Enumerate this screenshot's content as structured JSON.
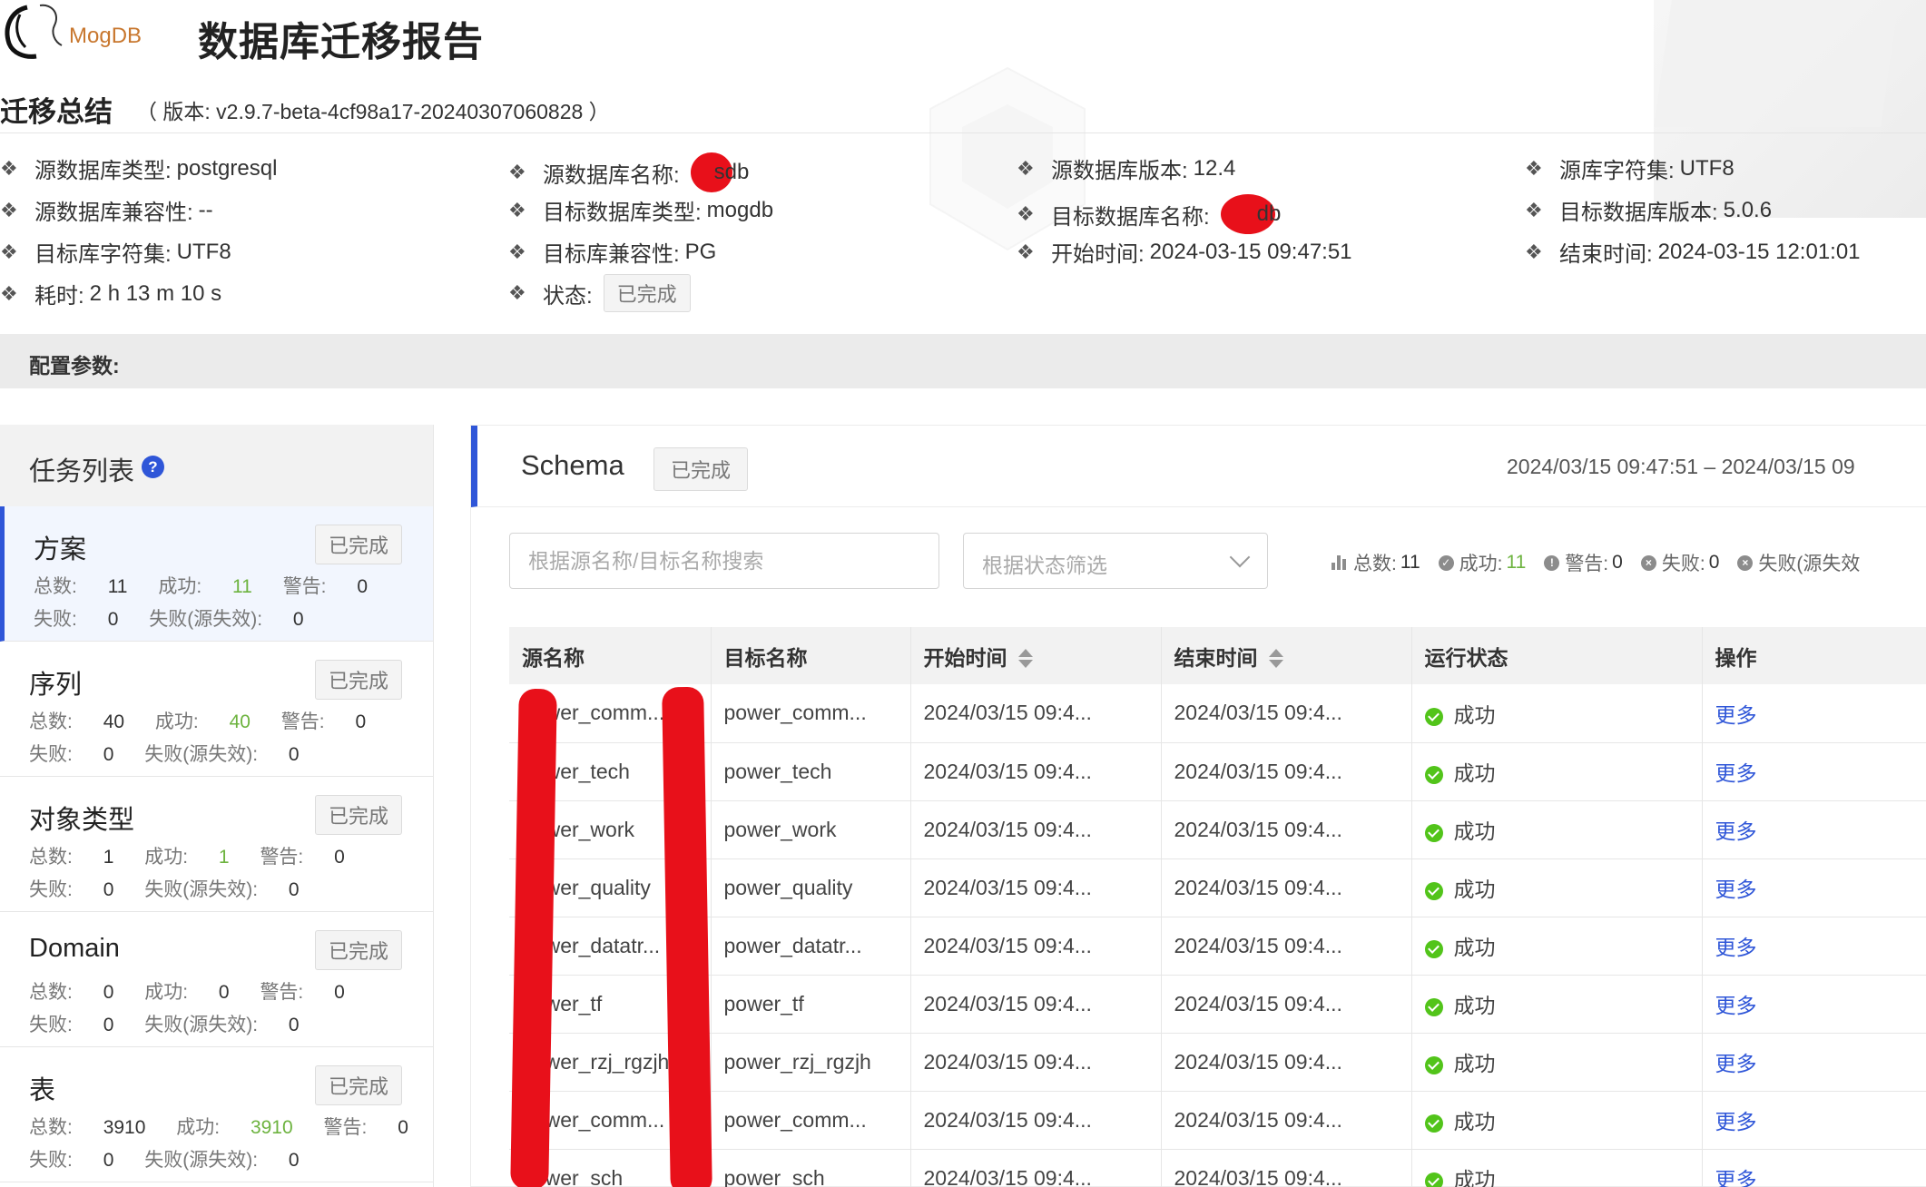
{
  "header": {
    "logo_text": "MogDB",
    "title": "数据库迁移报告"
  },
  "summary": {
    "title": "迁移总结",
    "version": "（ 版本: v2.9.7-beta-4cf98a17-20240307060828 ）",
    "items": [
      {
        "label": "源数据库类型:",
        "value": "postgresql"
      },
      {
        "label": "源数据库名称:",
        "value": "sdb"
      },
      {
        "label": "源数据库版本:",
        "value": "12.4"
      },
      {
        "label": "源库字符集:",
        "value": "UTF8"
      },
      {
        "label": "源数据库兼容性:",
        "value": "--"
      },
      {
        "label": "目标数据库类型:",
        "value": "mogdb"
      },
      {
        "label": "目标数据库名称:",
        "value": "db"
      },
      {
        "label": "目标数据库版本:",
        "value": "5.0.6"
      },
      {
        "label": "目标库字符集:",
        "value": "UTF8"
      },
      {
        "label": "目标库兼容性:",
        "value": "PG"
      },
      {
        "label": "开始时间:",
        "value": "2024-03-15 09:47:51"
      },
      {
        "label": "结束时间:",
        "value": "2024-03-15 12:01:01"
      },
      {
        "label": "耗时:",
        "value": "2 h 13 m 10 s"
      },
      {
        "label": "状态:",
        "value": "已完成"
      }
    ],
    "config_label": "配置参数:"
  },
  "tasks": {
    "title": "任务列表",
    "help": "?",
    "items": [
      {
        "name": "方案",
        "tag": "已完成",
        "total": "11",
        "success": "11",
        "warning": "0",
        "fail": "0",
        "fail_src": "0"
      },
      {
        "name": "序列",
        "tag": "已完成",
        "total": "40",
        "success": "40",
        "warning": "0",
        "fail": "0",
        "fail_src": "0"
      },
      {
        "name": "对象类型",
        "tag": "已完成",
        "total": "1",
        "success": "1",
        "warning": "0",
        "fail": "0",
        "fail_src": "0"
      },
      {
        "name": "Domain",
        "tag": "已完成",
        "total": "0",
        "success": "0",
        "warning": "0",
        "fail": "0",
        "fail_src": "0"
      },
      {
        "name": "表",
        "tag": "已完成",
        "total": "3910",
        "success": "3910",
        "warning": "0",
        "fail": "0",
        "fail_src": "0"
      }
    ],
    "labels": {
      "total": "总数:",
      "success": "成功:",
      "warning": "警告:",
      "fail": "失败:",
      "fail_src": "失败(源失效):"
    }
  },
  "main": {
    "title": "Schema",
    "tag": "已完成",
    "date_range": "2024/03/15 09:47:51 – 2024/03/15 09",
    "search_placeholder": "根据源名称/目标名称搜索",
    "status_placeholder": "根据状态筛选",
    "stats": {
      "total_label": "总数:",
      "total": "11",
      "success_label": "成功:",
      "success": "11",
      "warning_label": "警告:",
      "warning": "0",
      "fail_label": "失败:",
      "fail": "0",
      "fail_src_label": "失败(源失效"
    },
    "columns": [
      "源名称",
      "目标名称",
      "开始时间",
      "结束时间",
      "运行状态",
      "操作"
    ],
    "rows": [
      {
        "src": "power_comm...",
        "dst": "power_comm...",
        "start": "2024/03/15 09:4...",
        "end": "2024/03/15 09:4...",
        "status": "成功",
        "action": "更多"
      },
      {
        "src": "power_tech",
        "dst": "power_tech",
        "start": "2024/03/15 09:4...",
        "end": "2024/03/15 09:4...",
        "status": "成功",
        "action": "更多"
      },
      {
        "src": "power_work",
        "dst": "power_work",
        "start": "2024/03/15 09:4...",
        "end": "2024/03/15 09:4...",
        "status": "成功",
        "action": "更多"
      },
      {
        "src": "power_quality",
        "dst": "power_quality",
        "start": "2024/03/15 09:4...",
        "end": "2024/03/15 09:4...",
        "status": "成功",
        "action": "更多"
      },
      {
        "src": "power_datatr...",
        "dst": "power_datatr...",
        "start": "2024/03/15 09:4...",
        "end": "2024/03/15 09:4...",
        "status": "成功",
        "action": "更多"
      },
      {
        "src": "power_tf",
        "dst": "power_tf",
        "start": "2024/03/15 09:4...",
        "end": "2024/03/15 09:4...",
        "status": "成功",
        "action": "更多"
      },
      {
        "src": "power_rzj_rgzjh",
        "dst": "power_rzj_rgzjh",
        "start": "2024/03/15 09:4...",
        "end": "2024/03/15 09:4...",
        "status": "成功",
        "action": "更多"
      },
      {
        "src": "power_comm...",
        "dst": "power_comm...",
        "start": "2024/03/15 09:4...",
        "end": "2024/03/15 09:4...",
        "status": "成功",
        "action": "更多"
      },
      {
        "src": "power_sch",
        "dst": "power_sch",
        "start": "2024/03/15 09:4...",
        "end": "2024/03/15 09:4...",
        "status": "成功",
        "action": "更多"
      }
    ]
  }
}
